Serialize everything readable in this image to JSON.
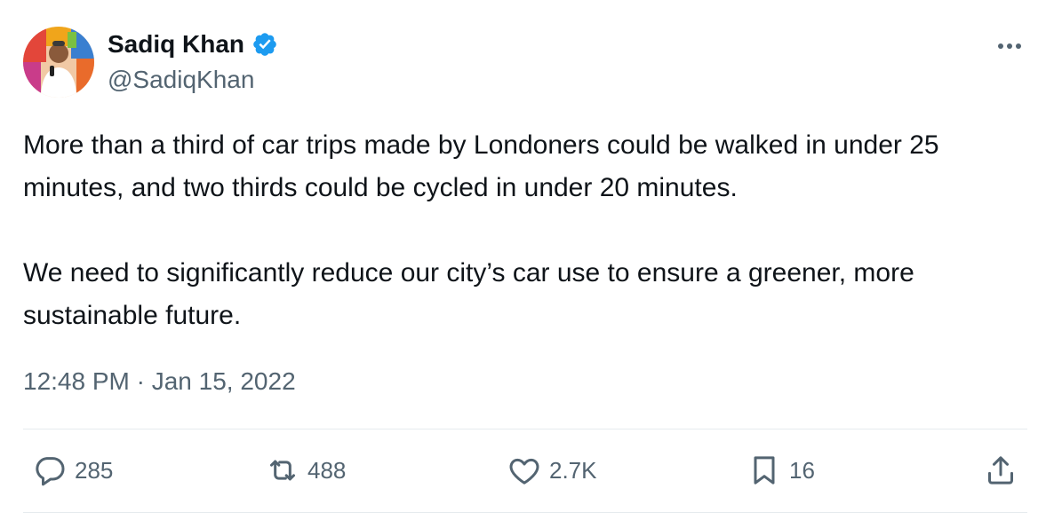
{
  "author": {
    "display_name": "Sadiq Khan",
    "handle": "@SadiqKhan",
    "verified": true,
    "avatar_icon": "profile-photo"
  },
  "tweet": {
    "paragraphs": [
      "More than a third of car trips made by Londoners could be walked in under 25 minutes, and two thirds could be cycled in under 20 minutes.",
      "We need to significantly reduce our city’s car use to ensure a greener, more sustainable future."
    ],
    "timestamp": "12:48 PM · Jan 15, 2022"
  },
  "actions": {
    "reply_count": "285",
    "retweet_count": "488",
    "like_count": "2.7K",
    "bookmark_count": "16",
    "more_icon": "more-horizontal-icon",
    "reply_icon": "reply-icon",
    "retweet_icon": "retweet-icon",
    "like_icon": "heart-icon",
    "bookmark_icon": "bookmark-icon",
    "share_icon": "share-icon"
  },
  "colors": {
    "text_primary": "#0f1419",
    "text_secondary": "#536471",
    "verified_blue": "#1d9bf0",
    "divider": "#e6ebee"
  }
}
